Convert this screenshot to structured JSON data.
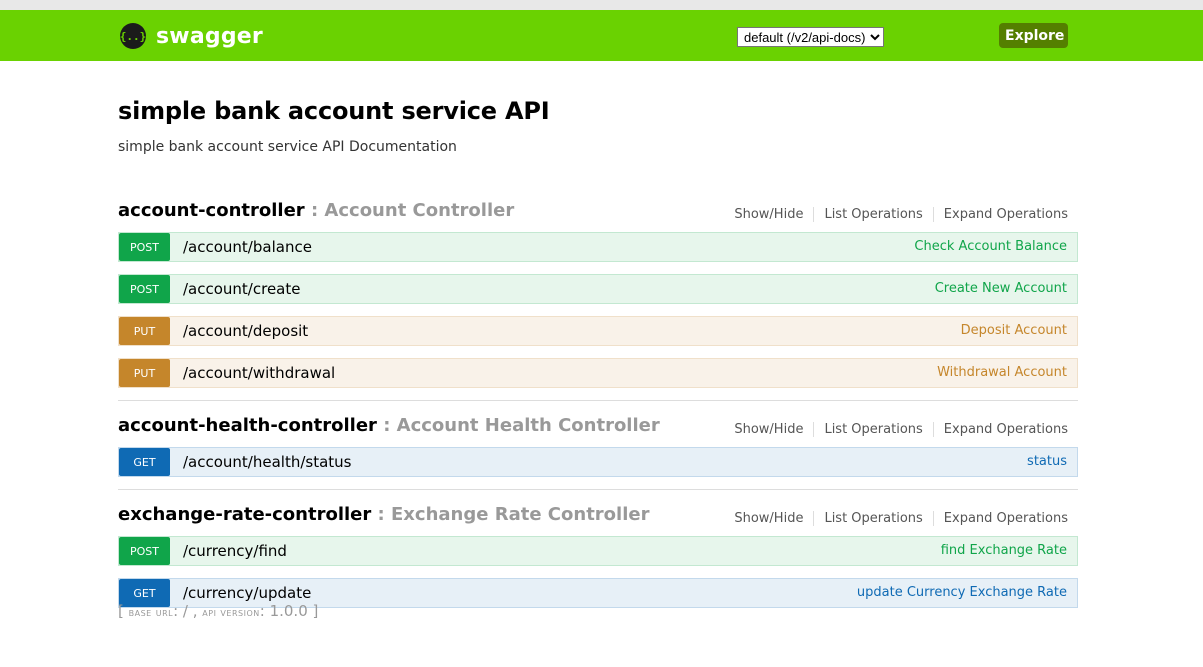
{
  "header": {
    "logo_glyph": "{..}",
    "brand": "swagger",
    "spec_selected": "default (/v2/api-docs)",
    "explore_label": "Explore",
    "bg_color": "#6ad201"
  },
  "info": {
    "title": "simple bank account service API",
    "description": "simple bank account service API Documentation"
  },
  "resource_options": {
    "show_hide": "Show/Hide",
    "list_operations": "List Operations",
    "expand_operations": "Expand Operations"
  },
  "resources": [
    {
      "name": "account-controller",
      "separator": " : ",
      "description": "Account Controller",
      "operations": [
        {
          "method": "POST",
          "path": "/account/balance",
          "summary": "Check Account Balance"
        },
        {
          "method": "POST",
          "path": "/account/create",
          "summary": "Create New Account"
        },
        {
          "method": "PUT",
          "path": "/account/deposit",
          "summary": "Deposit Account"
        },
        {
          "method": "PUT",
          "path": "/account/withdrawal",
          "summary": "Withdrawal Account"
        }
      ]
    },
    {
      "name": "account-health-controller",
      "separator": " : ",
      "description": "Account Health Controller",
      "operations": [
        {
          "method": "GET",
          "path": "/account/health/status",
          "summary": "status"
        }
      ]
    },
    {
      "name": "exchange-rate-controller",
      "separator": " : ",
      "description": "Exchange Rate Controller",
      "operations": [
        {
          "method": "POST",
          "path": "/currency/find",
          "summary": "find Exchange Rate"
        },
        {
          "method": "GET",
          "path": "/currency/update",
          "summary": "update Currency Exchange Rate"
        }
      ]
    }
  ],
  "footer": {
    "open": "[ ",
    "base_url_label": "base url",
    "base_url_value": ": / , ",
    "api_version_label": "api version",
    "api_version_value": ": 1.0.0 ",
    "close": "]"
  },
  "colors": {
    "post": "#10a54a",
    "put": "#c5862b",
    "get": "#0f6ab4"
  }
}
